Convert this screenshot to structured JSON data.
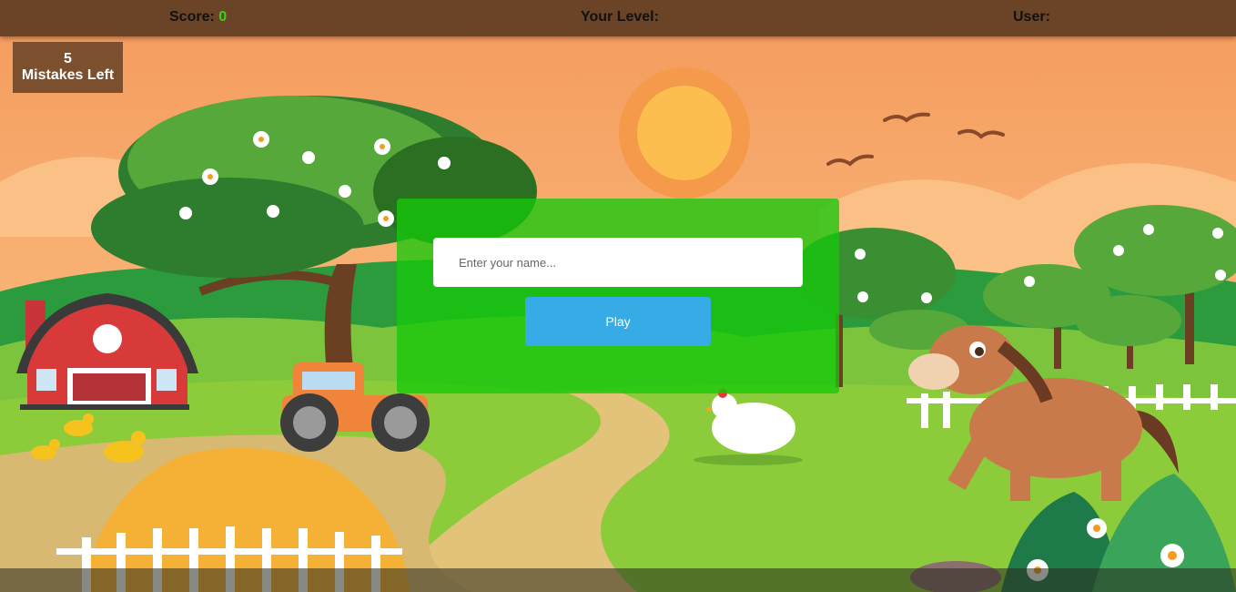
{
  "hud": {
    "score_label": "Score:",
    "score_value": "0",
    "level_label": "Your Level:",
    "level_value": "",
    "user_label": "User:",
    "user_value": ""
  },
  "mistakes": {
    "count": "5",
    "label": "Mistakes Left"
  },
  "login": {
    "placeholder": "Enter your name...",
    "value": "",
    "play_label": "Play"
  },
  "colors": {
    "topbar": "#6b4427",
    "score": "#3bd11a",
    "panel": "#16c80a",
    "play_button": "#36abe6",
    "sky": "#f6a868"
  }
}
